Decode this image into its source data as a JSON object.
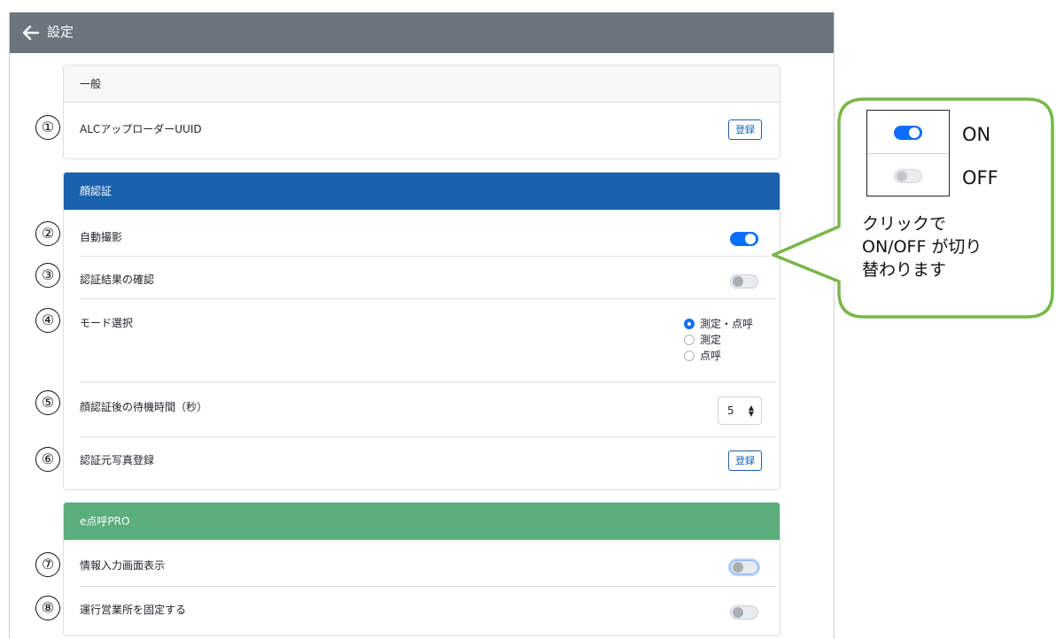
{
  "appbar": {
    "title": "設定",
    "back_icon": "arrow-left-icon"
  },
  "sections": {
    "general": {
      "header": "一般",
      "uuid_label": "ALCアップローダーUUID",
      "uuid_button": "登録"
    },
    "face": {
      "header": "顔認証",
      "auto_capture_label": "自動撮影",
      "auto_capture_on": true,
      "confirm_result_label": "認証結果の確認",
      "confirm_result_on": false,
      "mode_label": "モード選択",
      "mode_options": [
        "測定・点呼",
        "測定",
        "点呼"
      ],
      "mode_selected": "測定・点呼",
      "wait_label": "顔認証後の待機時間（秒）",
      "wait_value": "5",
      "photo_label": "認証元写真登録",
      "photo_button": "登録"
    },
    "pro": {
      "header": "e点呼PRO",
      "info_screen_label": "情報入力画面表示",
      "info_screen_on": false,
      "fix_office_label": "運行営業所を固定する",
      "fix_office_on": false
    }
  },
  "markers": [
    "①",
    "②",
    "③",
    "④",
    "⑤",
    "⑥",
    "⑦",
    "⑧"
  ],
  "callout": {
    "on_label": "ON",
    "off_label": "OFF",
    "text_lines": [
      "クリックで",
      "ON/OFF が切り",
      "替わります"
    ]
  },
  "colors": {
    "appbar": "#6c757d",
    "face_header": "#1a62ad",
    "pro_header": "#5aae7c",
    "toggle_on": "#0d6efd",
    "callout_border": "#7ab648"
  }
}
